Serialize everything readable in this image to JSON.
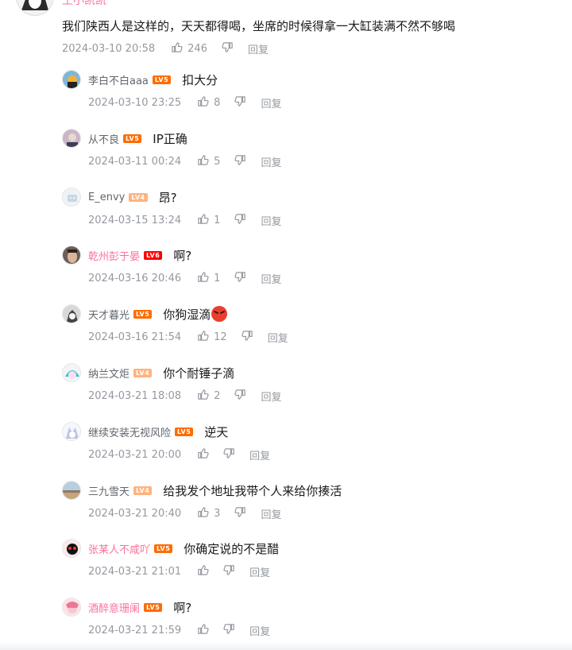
{
  "root": {
    "name": "王小凯凯",
    "text": "我们陕西人是这样的，天天都得喝，坐席的时候得拿一大缸装满不然不够喝",
    "date": "2024-03-10 20:58",
    "likes": "246",
    "reply_label": "回复"
  },
  "replies": [
    {
      "name": "李白不白aaa",
      "level": "LV5",
      "text": "扣大分",
      "date": "2024-03-10 23:25",
      "likes": "8"
    },
    {
      "name": "从不良",
      "level": "LV5",
      "text": "IP正确",
      "date": "2024-03-11 00:24",
      "likes": "5"
    },
    {
      "name": "E_envy",
      "level": "LV4",
      "text": "昂?",
      "date": "2024-03-15 13:24",
      "likes": "1"
    },
    {
      "name": "乾州彭于晏",
      "level": "LV6",
      "text": "啊?",
      "date": "2024-03-16 20:46",
      "likes": "1"
    },
    {
      "name": "天才暮光",
      "level": "LV5",
      "text": "你狗湿滴",
      "date": "2024-03-16 21:54",
      "likes": "12"
    },
    {
      "name": "纳兰文炬",
      "level": "LV4",
      "text": "你个耐锤子滴",
      "date": "2024-03-21 18:08",
      "likes": "2"
    },
    {
      "name": "继续安装无视风险",
      "level": "LV5",
      "text": "逆天",
      "date": "2024-03-21 20:00",
      "likes": ""
    },
    {
      "name": "三九雪天",
      "level": "LV4",
      "text": "给我发个地址我带个人来给你揍活",
      "date": "2024-03-21 20:40",
      "likes": "3"
    },
    {
      "name": "张某人不咸吖",
      "level": "LV5",
      "text": "你确定说的不是醋",
      "date": "2024-03-21 21:01",
      "likes": ""
    },
    {
      "name": "酒醉意珊阑",
      "level": "LV5",
      "text": "啊?",
      "date": "2024-03-21 21:59",
      "likes": ""
    }
  ],
  "reply_label": "回复",
  "icons": {
    "like": "thumb-up-icon",
    "dislike": "thumb-down-icon",
    "emoji": "angry-face-emoji-icon"
  },
  "colors": {
    "vip_name": "#fb7299",
    "lv5": "#ff6c00",
    "lv6": "#ff0000",
    "lv4": "#ffb37c",
    "meta": "#9499a0"
  }
}
